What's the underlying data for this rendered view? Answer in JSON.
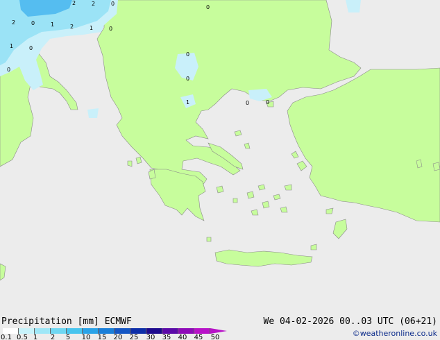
{
  "map": {
    "colors": {
      "sea": "#ececec",
      "land": "#c7fd9c",
      "coast": "#8a8a8a",
      "precip_light": "#c9f0fa",
      "precip_medium": "#9be3f6",
      "precip_strong": "#55bdf0"
    },
    "value_labels": [
      "2",
      "2",
      "0",
      "0",
      "2",
      "0",
      "1",
      "2",
      "1",
      "0",
      "1",
      "0",
      "0",
      "0",
      "0",
      "1",
      "0",
      "0"
    ]
  },
  "footer": {
    "title": "Precipitation [mm]  ECMWF",
    "datetime": "We 04-02-2026 00..03 UTC (06+21)",
    "credit": "©weatheronline.co.uk",
    "scale_colors": [
      "#ffffff",
      "#c8f3fb",
      "#9ee7f7",
      "#6fd7f2",
      "#47c4ee",
      "#2aa3e8",
      "#1a7fd9",
      "#1456c4",
      "#0d2ea8",
      "#1d0a8e",
      "#5b0aa8",
      "#8e0ab8",
      "#b812c8"
    ],
    "scale_labels": [
      "0.1",
      "0.5",
      "1",
      "2",
      "5",
      "10",
      "15",
      "20",
      "25",
      "30",
      "35",
      "40",
      "45",
      "50"
    ]
  }
}
